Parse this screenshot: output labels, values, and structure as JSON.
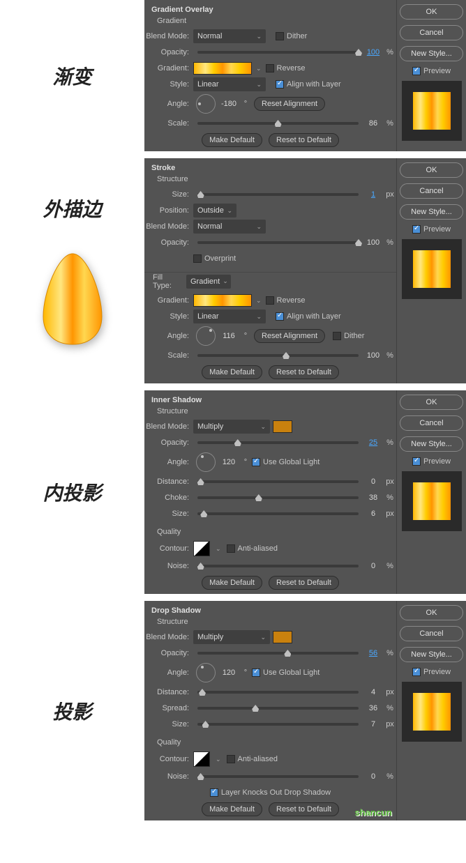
{
  "labels": {
    "gradient": "渐变",
    "stroke": "外描边",
    "innerShadow": "内投影",
    "dropShadow": "投影"
  },
  "side": {
    "ok": "OK",
    "cancel": "Cancel",
    "newStyle": "New Style...",
    "preview": "Preview"
  },
  "common": {
    "blendMode": "Blend Mode:",
    "opacity": "Opacity:",
    "gradient": "Gradient:",
    "style": "Style:",
    "angle": "Angle:",
    "scale": "Scale:",
    "size": "Size:",
    "position": "Position:",
    "fillType": "Fill Type:",
    "distance": "Distance:",
    "choke": "Choke:",
    "spread": "Spread:",
    "contour": "Contour:",
    "noise": "Noise:",
    "makeDefault": "Make Default",
    "resetDefault": "Reset to Default",
    "resetAlign": "Reset Alignment",
    "dither": "Dither",
    "reverse": "Reverse",
    "alignLayer": "Align with Layer",
    "overprint": "Overprint",
    "antiAliased": "Anti-aliased",
    "useGlobal": "Use Global Light",
    "knockOut": "Layer Knocks Out Drop Shadow",
    "structure": "Structure",
    "quality": "Quality",
    "pct": "%",
    "px": "px",
    "deg": "°"
  },
  "panel1": {
    "title": "Gradient Overlay",
    "sub": "Gradient",
    "blendMode": "Normal",
    "opacity": "100",
    "style": "Linear",
    "angle": "-180",
    "scale": "86"
  },
  "panel2": {
    "title": "Stroke",
    "size": "1",
    "position": "Outside",
    "blendMode": "Normal",
    "opacity": "100",
    "fillType": "Gradient",
    "style": "Linear",
    "angle": "116",
    "scale": "100"
  },
  "panel3": {
    "title": "Inner Shadow",
    "blendMode": "Multiply",
    "opacity": "25",
    "angle": "120",
    "distance": "0",
    "choke": "38",
    "size": "6",
    "noise": "0"
  },
  "panel4": {
    "title": "Drop Shadow",
    "blendMode": "Multiply",
    "opacity": "56",
    "angle": "120",
    "distance": "4",
    "spread": "36",
    "size": "7",
    "noise": "0"
  },
  "watermark": "shancun"
}
